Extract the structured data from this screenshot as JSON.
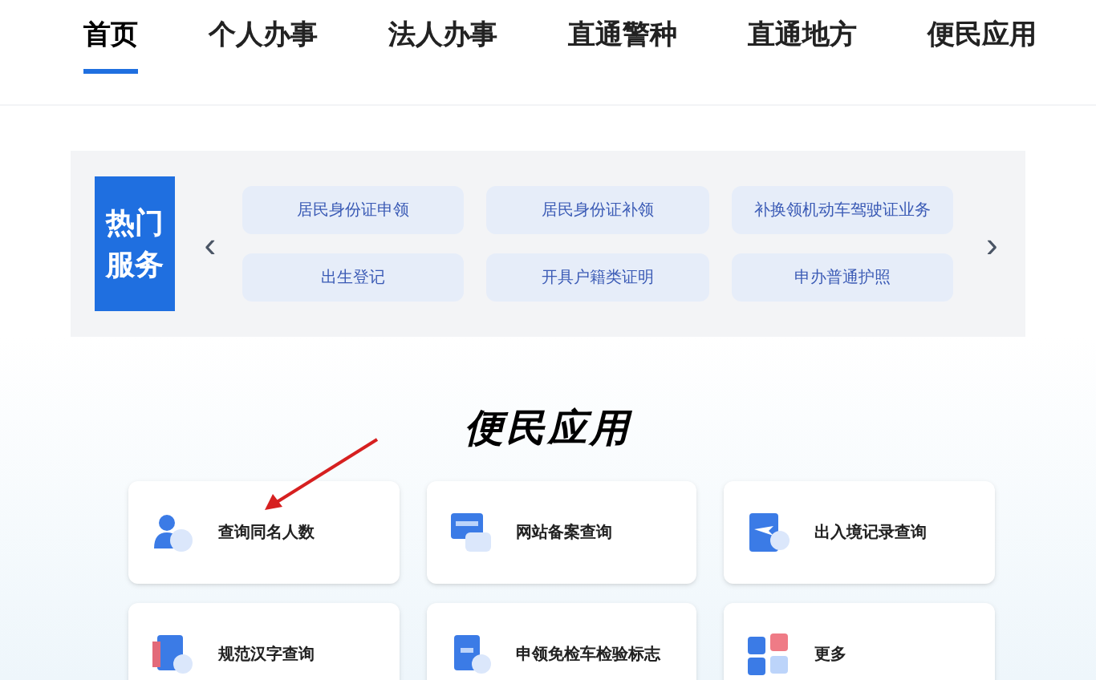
{
  "nav_tabs": [
    {
      "label": "首页",
      "selected": true
    },
    {
      "label": "个人办事",
      "selected": false
    },
    {
      "label": "法人办事",
      "selected": false
    },
    {
      "label": "直通警种",
      "selected": false
    },
    {
      "label": "直通地方",
      "selected": false
    },
    {
      "label": "便民应用",
      "selected": false
    }
  ],
  "hot_services": {
    "title": [
      "热门",
      "服务"
    ],
    "prev": "‹",
    "next": "›",
    "items": [
      "居民身份证申领",
      "居民身份证补领",
      "补换领机动车驾驶证业务",
      "出生登记",
      "开具户籍类证明",
      "申办普通护照"
    ]
  },
  "apps": {
    "title": "便民应用",
    "items": [
      {
        "label": "查询同名人数"
      },
      {
        "label": "网站备案查询"
      },
      {
        "label": "出入境记录查询"
      },
      {
        "label": "规范汉字查询"
      },
      {
        "label": "申领免检车检验标志"
      },
      {
        "label": "更多"
      }
    ]
  }
}
